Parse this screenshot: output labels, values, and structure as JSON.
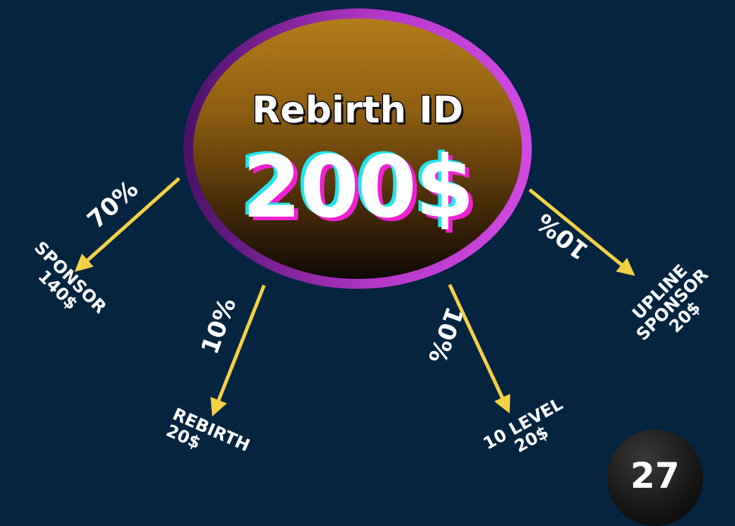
{
  "hub": {
    "title": "Rebirth ID",
    "amount": "200$"
  },
  "branches": {
    "sponsor": {
      "percent": "70%",
      "label_line1": "SPONSOR",
      "label_line2": "140$"
    },
    "rebirth": {
      "percent": "10%",
      "label_line1": "REBIRTH",
      "label_line2": "20$"
    },
    "ten_level": {
      "percent": "10%",
      "label_line1": "10 LEVEL",
      "label_line2": "20$"
    },
    "upline_sponsor": {
      "percent": "10%",
      "label_line1": "UPLINE",
      "label_line2": "SPONSOR",
      "label_line3": "20$"
    }
  },
  "page_number": "27",
  "colors": {
    "background": "#05243f",
    "arrow": "#f3d045",
    "hub_ring": "#c23fd5",
    "hub_fill_top": "#b17d1a",
    "hub_fill_bottom": "#0f0803",
    "amount_cyan": "#1fe6f0",
    "amount_magenta": "#ee21d3",
    "text": "#ffffff"
  }
}
